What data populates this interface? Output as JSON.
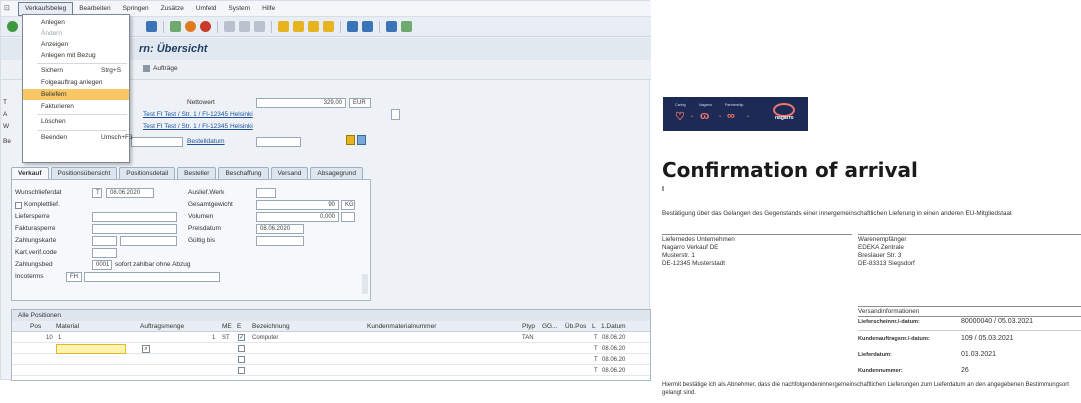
{
  "menubar": {
    "items": [
      "Verkaufsbeleg",
      "Bearbeiten",
      "Springen",
      "Zusätze",
      "Umfeld",
      "System",
      "Hilfe"
    ]
  },
  "title": {
    "suffix": "rn: Übersicht"
  },
  "app_toolbar": {
    "auftraege": "Aufträge"
  },
  "dropdown_menu": {
    "items": [
      {
        "label": "Anlegen",
        "shortcut": "",
        "disabled": false
      },
      {
        "label": "Ändern",
        "shortcut": "",
        "disabled": true
      },
      {
        "label": "Anzeigen",
        "shortcut": "",
        "disabled": false
      },
      {
        "label": "Anlegen mit Bezug",
        "shortcut": "",
        "disabled": false
      },
      {
        "label": "Sichern",
        "shortcut": "Strg+S",
        "disabled": false
      },
      {
        "label": "Folgeauftrag anlegen",
        "shortcut": "",
        "disabled": false
      },
      {
        "label": "Beliefern",
        "shortcut": "",
        "disabled": false,
        "highlighted": true
      },
      {
        "label": "Fakturieren",
        "shortcut": "",
        "disabled": false
      },
      {
        "label": "Löschen",
        "shortcut": "",
        "disabled": false
      },
      {
        "label": "Beenden",
        "shortcut": "Umsch+F3",
        "disabled": false
      }
    ]
  },
  "header": {
    "nettowert_label": "Nettowert",
    "nettowert_value": "329,00",
    "currency": "EUR",
    "partner1": "Test FI Test / Str. 1 / FI-12345 Helsinki",
    "partner2": "Test FI Test / Str. 1 / FI-12345 Helsinki",
    "bestelldatum_label": "Bestelldatum",
    "row_labels": [
      "T",
      "A",
      "W",
      "Be"
    ]
  },
  "tabs": [
    "Verkauf",
    "Positionsübersicht",
    "Positionsdetail",
    "Besteller",
    "Beschaffung",
    "Versand",
    "Absagegrund"
  ],
  "form": {
    "wunschlieferdat_label": "Wunschlieferdat",
    "wunschlieferdat_t": "T",
    "wunschlieferdat_value": "08.06.2020",
    "komplettlief_label": "Komplettlief.",
    "liefersperre_label": "Liefersperre",
    "fakturasperre_label": "Fakturasperre",
    "zahlungskarte_label": "Zahlungskarte",
    "kartverif_label": "Kart.verif.code",
    "zahlungsbed_label": "Zahlungsbed",
    "zahlungsbed_code": "0001",
    "zahlungsbed_text": "sofort zahlbar ohne Abzug",
    "incoterms_label": "Incoterms",
    "incoterms_value": "FH",
    "auslieferwerk_label": "Auslief.Werk",
    "gesamtgewicht_label": "Gesamtgewicht",
    "gesamtgewicht_value": "90",
    "gesamtgewicht_unit": "KG",
    "volumen_label": "Volumen",
    "volumen_value": "0,000",
    "preisdatum_label": "Preisdatum",
    "preisdatum_value": "08.06.2020",
    "gueltig_bis_label": "Gültig bis"
  },
  "positions": {
    "caption": "Alle Positionen",
    "columns": [
      "Pos",
      "Material",
      "Auftragsmenge",
      "ME",
      "E",
      "Bezeichnung",
      "Kundenmaterialnummer",
      "Ptyp",
      "GG...",
      "Üb.Pos",
      "L",
      "1.Datum"
    ],
    "rows": [
      {
        "pos": "10",
        "material": "1",
        "menge": "1",
        "me": "ST",
        "bez": "Computer",
        "ptyp": "TAN",
        "l": "T",
        "datum": "08.06.20"
      },
      {
        "pos": "",
        "material": "",
        "menge": "",
        "me": "",
        "bez": "",
        "ptyp": "",
        "l": "T",
        "datum": "08.06.20"
      },
      {
        "pos": "",
        "material": "",
        "menge": "",
        "me": "",
        "bez": "",
        "ptyp": "",
        "l": "T",
        "datum": "08.06.20"
      },
      {
        "pos": "",
        "material": "",
        "menge": "",
        "me": "",
        "bez": "",
        "ptyp": "",
        "l": "T",
        "datum": "08.06.20"
      }
    ]
  },
  "document": {
    "logo": {
      "taglines": [
        "Caring",
        "Nagarro",
        "Partnership"
      ],
      "brand": "nagarro"
    },
    "title": "Confirmation of arrival",
    "intro": "Bestätigung über das Gelangen des Gegenstands einer innergemeinschaftlichen Lieferung in einen anderen EU-Mitgliedstaat",
    "sender_heading": "Liefernedes Unternehmen",
    "sender_lines": [
      "Nagarro Verkauf DE",
      "Musterstr. 1",
      "DE-12345 Musterstadt"
    ],
    "receiver_heading": "Warenempfänger",
    "receiver_lines": [
      "EDEKA Zentrale",
      "Breslauer Str. 3",
      "DE-83313 Siegsdorf"
    ],
    "shipping_heading": "Versandinformationen",
    "shipping": [
      {
        "label": "Lieferscheinnr./-datum:",
        "value": "80000040 / 05.03.2021"
      },
      {
        "label": "Kundenauftragsnr./-datum:",
        "value": "109 / 05.03.2021"
      },
      {
        "label": "Lieferdatum:",
        "value": "01.03.2021"
      },
      {
        "label": "Kundennummer:",
        "value": "26"
      }
    ],
    "footer": "Hiermit bestätige ich als Abnehmer, dass die nachfolgendeninnergemeinschaftlichen Lieferungen zum Lieferdatum an den angegebenen Bestimmungsort gelangt sind."
  }
}
